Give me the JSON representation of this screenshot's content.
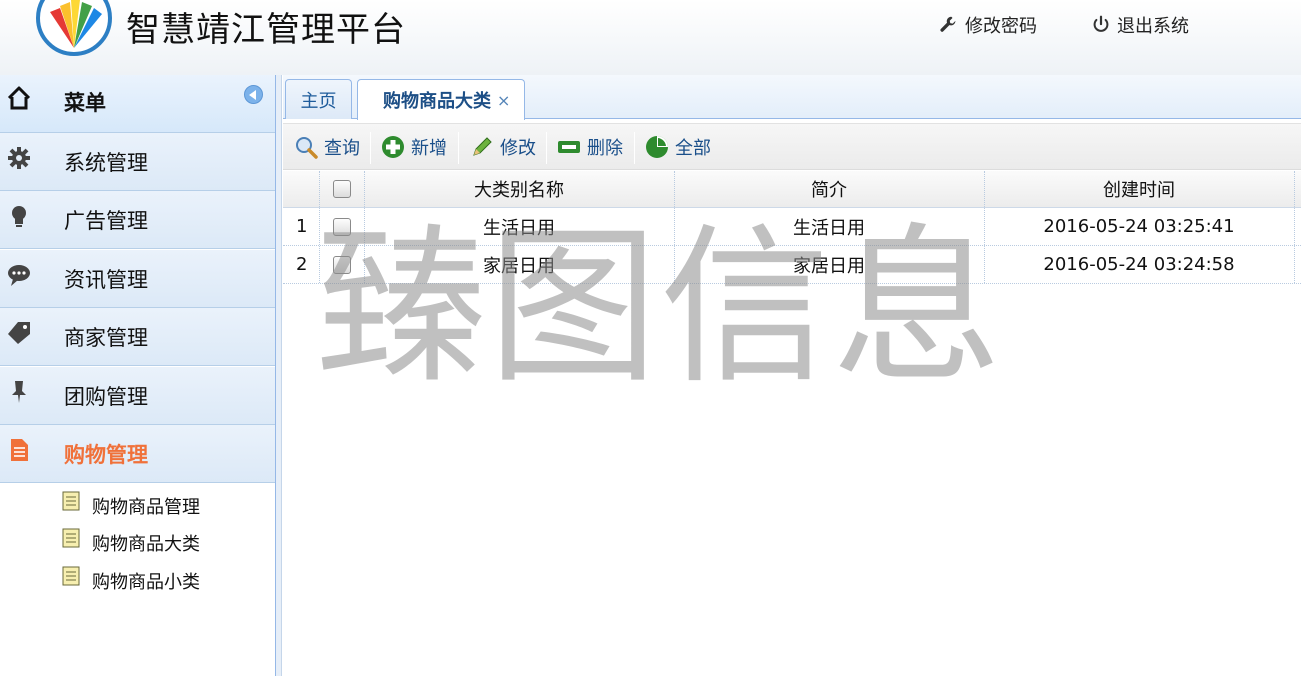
{
  "header": {
    "app_title": "智慧靖江管理平台",
    "change_password": "修改密码",
    "logout": "退出系统"
  },
  "sidebar": {
    "title": "菜单",
    "groups": [
      {
        "label": "系统管理",
        "icon": "gear-icon"
      },
      {
        "label": "广告管理",
        "icon": "lightbulb-icon"
      },
      {
        "label": "资讯管理",
        "icon": "chat-bubble-icon"
      },
      {
        "label": "商家管理",
        "icon": "tag-icon"
      },
      {
        "label": "团购管理",
        "icon": "pin-icon"
      },
      {
        "label": "购物管理",
        "icon": "document-icon",
        "active": true
      }
    ],
    "sub_items": [
      {
        "label": "购物商品管理"
      },
      {
        "label": "购物商品大类"
      },
      {
        "label": "购物商品小类"
      }
    ]
  },
  "tabs": [
    {
      "label": "主页"
    },
    {
      "label": "购物商品大类",
      "selected": true,
      "close": "×"
    }
  ],
  "toolbar": {
    "query": "查询",
    "add": "新增",
    "edit": "修改",
    "delete": "删除",
    "all": "全部"
  },
  "grid": {
    "columns": [
      "大类别名称",
      "简介",
      "创建时间"
    ],
    "rows": [
      {
        "num": "1",
        "name": "生活日用",
        "desc": "生活日用",
        "created": "2016-05-24 03:25:41"
      },
      {
        "num": "2",
        "name": "家居日用",
        "desc": "家居日用",
        "created": "2016-05-24 03:24:58"
      }
    ]
  },
  "watermark": "臻图信息",
  "colors": {
    "accent": "#1d5b9b",
    "active_menu": "#f0713a",
    "border": "#95b8e7"
  }
}
